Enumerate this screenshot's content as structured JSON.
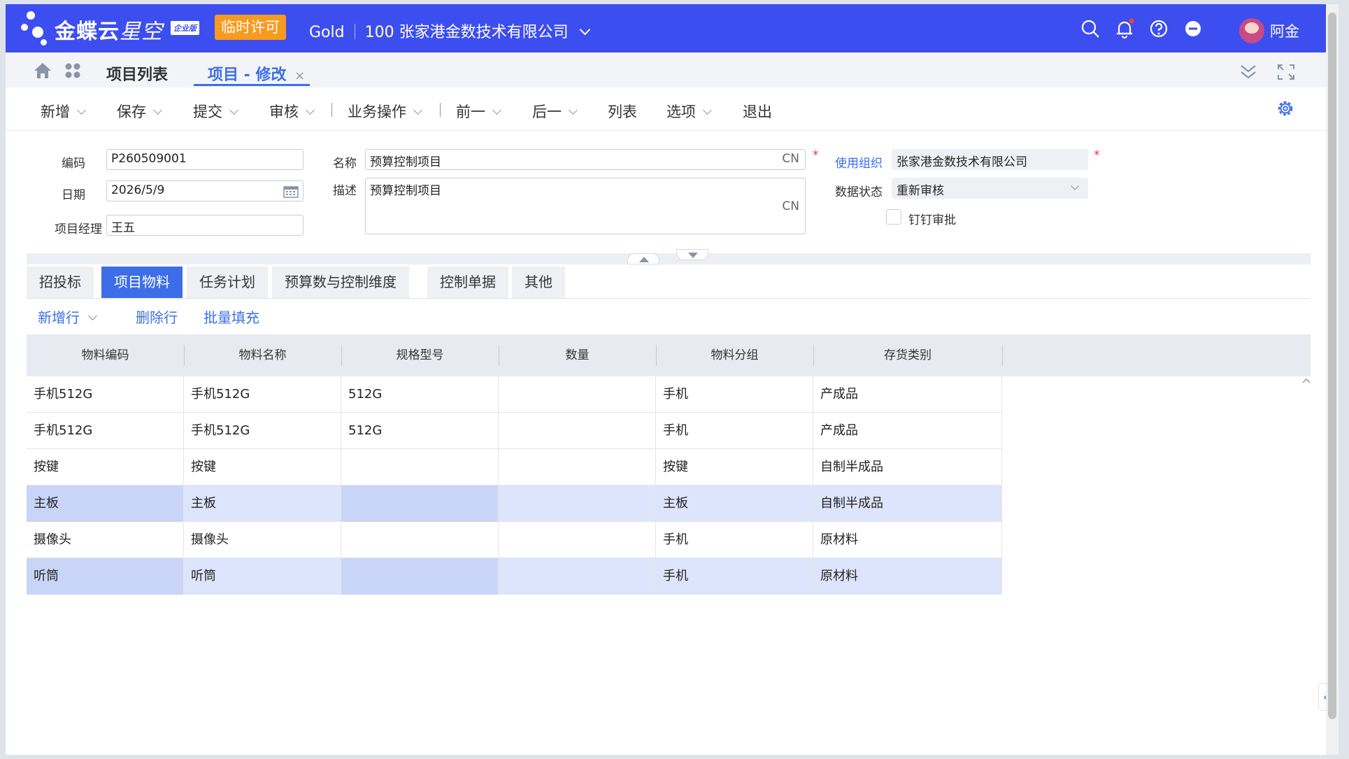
{
  "header": {
    "brand_main": "金蝶云",
    "brand_sub": "星空",
    "edition": "企业版",
    "license_badge": "临时许可",
    "product": "Gold",
    "org": "100 张家港金数技术有限公司",
    "user_name": "阿金",
    "icons": [
      "search-icon",
      "bell-icon",
      "help-icon",
      "more-icon"
    ],
    "accent": "#3d4ef0"
  },
  "tabs": {
    "list_tab": "项目列表",
    "active_tab": "项目 - 修改",
    "close_symbol": "×"
  },
  "toolbar": {
    "new": "新增",
    "save": "保存",
    "submit": "提交",
    "audit": "审核",
    "business": "业务操作",
    "prev": "前一",
    "next": "后一",
    "list": "列表",
    "options": "选项",
    "exit": "退出"
  },
  "form": {
    "code_label": "编码",
    "code_value": "P260509001",
    "date_label": "日期",
    "date_value": "2026/5/9",
    "manager_label": "项目经理",
    "manager_value": "王五",
    "name_label": "名称",
    "name_value": "预算控制项目",
    "desc_label": "描述",
    "desc_value": "预算控制项目",
    "lang_tag": "CN",
    "org_label": "使用组织",
    "org_value": "张家港金数技术有限公司",
    "status_label": "数据状态",
    "status_value": "重新审核",
    "dingtalk_label": "钉钉审批",
    "required_mark": "*"
  },
  "subtabs": [
    "招投标",
    "项目物料",
    "任务计划",
    "预算数与控制维度",
    "控制单据",
    "其他"
  ],
  "subbar": {
    "add_row": "新增行",
    "delete_row": "删除行",
    "batch_fill": "批量填充"
  },
  "grid": {
    "columns": [
      "物料编码",
      "物料名称",
      "规格型号",
      "数量",
      "物料分组",
      "存货类别"
    ],
    "rows": [
      [
        "手机512G",
        "手机512G",
        "512G",
        "",
        "手机",
        "产成品"
      ],
      [
        "手机512G",
        "手机512G",
        "512G",
        "",
        "手机",
        "产成品"
      ],
      [
        "按键",
        "按键",
        "",
        "",
        "按键",
        "自制半成品"
      ],
      [
        "主板",
        "主板",
        "",
        "",
        "主板",
        "自制半成品"
      ],
      [
        "摄像头",
        "摄像头",
        "",
        "",
        "手机",
        "原材料"
      ],
      [
        "听筒",
        "听筒",
        "",
        "",
        "手机",
        "原材料"
      ]
    ]
  }
}
